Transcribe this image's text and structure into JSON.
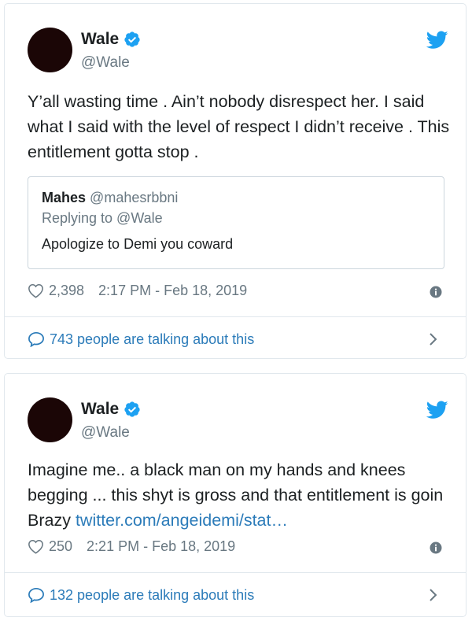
{
  "tweets": [
    {
      "author": {
        "name": "Wale",
        "handle": "@Wale"
      },
      "text": "Y’all wasting time . Ain’t nobody disrespect her. I said what I said with the level of respect I didn’t receive . This entitlement gotta stop .",
      "quote": {
        "name": "Mahes",
        "handle": "@mahesrbbni",
        "replying_to": "Replying to @Wale",
        "text": "Apologize to Demi you coward"
      },
      "likes": "2,398",
      "timestamp": "2:17 PM - Feb 18, 2019",
      "talking": "743 people are talking about this"
    },
    {
      "author": {
        "name": "Wale",
        "handle": "@Wale"
      },
      "text": "Imagine me.. a black man on my hands and knees begging ... this shyt is gross and that entitlement is goin Brazy ",
      "link": "twitter.com/angeidemi/stat…",
      "likes": "250",
      "timestamp": "2:21 PM - Feb 18, 2019",
      "talking": "132 people are talking about this"
    }
  ],
  "icons": {
    "verified": "verified-badge-icon",
    "bird": "twitter-bird-icon",
    "heart": "heart-icon",
    "info": "info-icon",
    "bubble": "speech-bubble-icon",
    "chevron": "chevron-right-icon"
  },
  "colors": {
    "brand_blue": "#1da1f2",
    "link_blue": "#2b7bb9",
    "text": "#1c2022",
    "muted": "#697882",
    "border": "#e1e8ed"
  }
}
